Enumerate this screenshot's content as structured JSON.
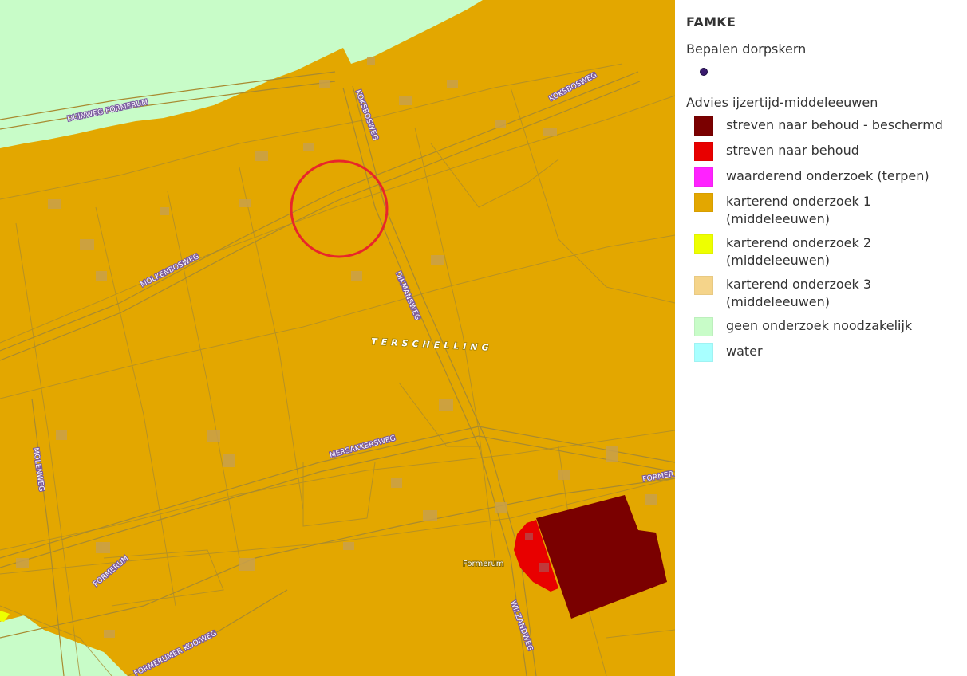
{
  "legend": {
    "title": "FAMKE",
    "layers": [
      {
        "title": "Bepalen dorpskern",
        "symbol": "dot",
        "color": "#3a1a6e"
      },
      {
        "title": "Advies ijzertijd-middeleeuwen",
        "items": [
          {
            "label": "streven naar behoud - beschermd",
            "color": "#7a0000"
          },
          {
            "label": "streven naar behoud",
            "color": "#e80000"
          },
          {
            "label": "waarderend onderzoek (terpen)",
            "color": "#ff22ff"
          },
          {
            "label": "karterend onderzoek 1 (middeleeuwen)",
            "color": "#e3a700"
          },
          {
            "label": "karterend onderzoek 2 (middeleeuwen)",
            "color": "#eeff00"
          },
          {
            "label": "karterend onderzoek 3 (middeleeuwen)",
            "color": "#f5d48a"
          },
          {
            "label": "geen onderzoek noodzakelijk",
            "color": "#c8fcc8"
          },
          {
            "label": "water",
            "color": "#a8ffff"
          }
        ]
      }
    ]
  },
  "map": {
    "labels": {
      "duinweg": "DUINWEG FORMERUM",
      "koksbosweg_1": "KOKSBOSWEG",
      "koksbosweg_2": "KOKSBOSWEG",
      "molkenbosweg": "MOLKENBOSWEG",
      "dikmansweg": "DIKMANSWEG",
      "terschelling": "TERSCHELLING",
      "mersakkersweg": "MERSAKKERSWEG",
      "molenweg": "MOLENWEG",
      "formerum_road": "FORMERUM",
      "formerum_road_2": "FORMER",
      "formerum_place": "Formerum",
      "wilzandweg": "WILZANDWEG",
      "koodweg": "FORMERUMER KOOIWEG"
    },
    "colors": {
      "background": "#e3a700",
      "green_zone": "#c8fcc8",
      "dark_red_zone": "#7a0000",
      "red_zone": "#e80000",
      "yellow_zone": "#eeff00",
      "road_line": "#a88a30",
      "building": "#c9a04a",
      "highlight_circle": "#e8262a"
    }
  }
}
